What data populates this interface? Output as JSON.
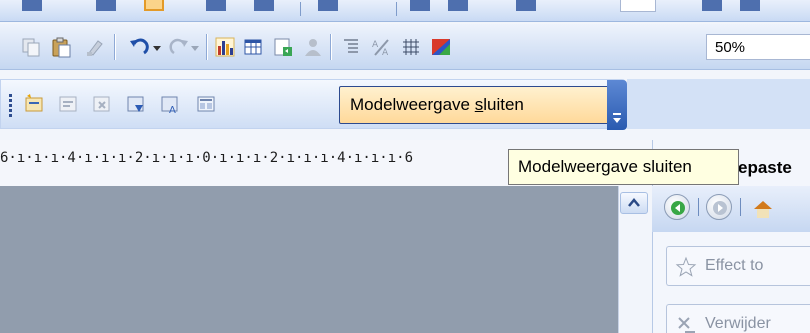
{
  "toolbar": {
    "zoom_value": "50%"
  },
  "model_toolbar": {
    "close_label_before": "Modelweergave ",
    "close_label_accel": "s",
    "close_label_after": "luiten"
  },
  "ruler": {
    "labels": "6·ı·ı·ı·4·ı·ı·ı·2·ı·ı·ı·0·ı·ı·ı·2·ı·ı·ı·4·ı·ı·ı·6"
  },
  "tooltip": {
    "text": "Modelweergave sluiten"
  },
  "task_pane": {
    "title": "epaste",
    "buttons": [
      {
        "label": "Effect to",
        "icon": "star-icon"
      },
      {
        "label": "Verwijder",
        "icon": "remove-icon"
      }
    ]
  },
  "colors": {
    "toolbar_blue": "#c5d7f1",
    "highlight_orange": "#ffd99a",
    "tooltip_yellow": "#ffffe1",
    "canvas_gray": "#919dad"
  }
}
